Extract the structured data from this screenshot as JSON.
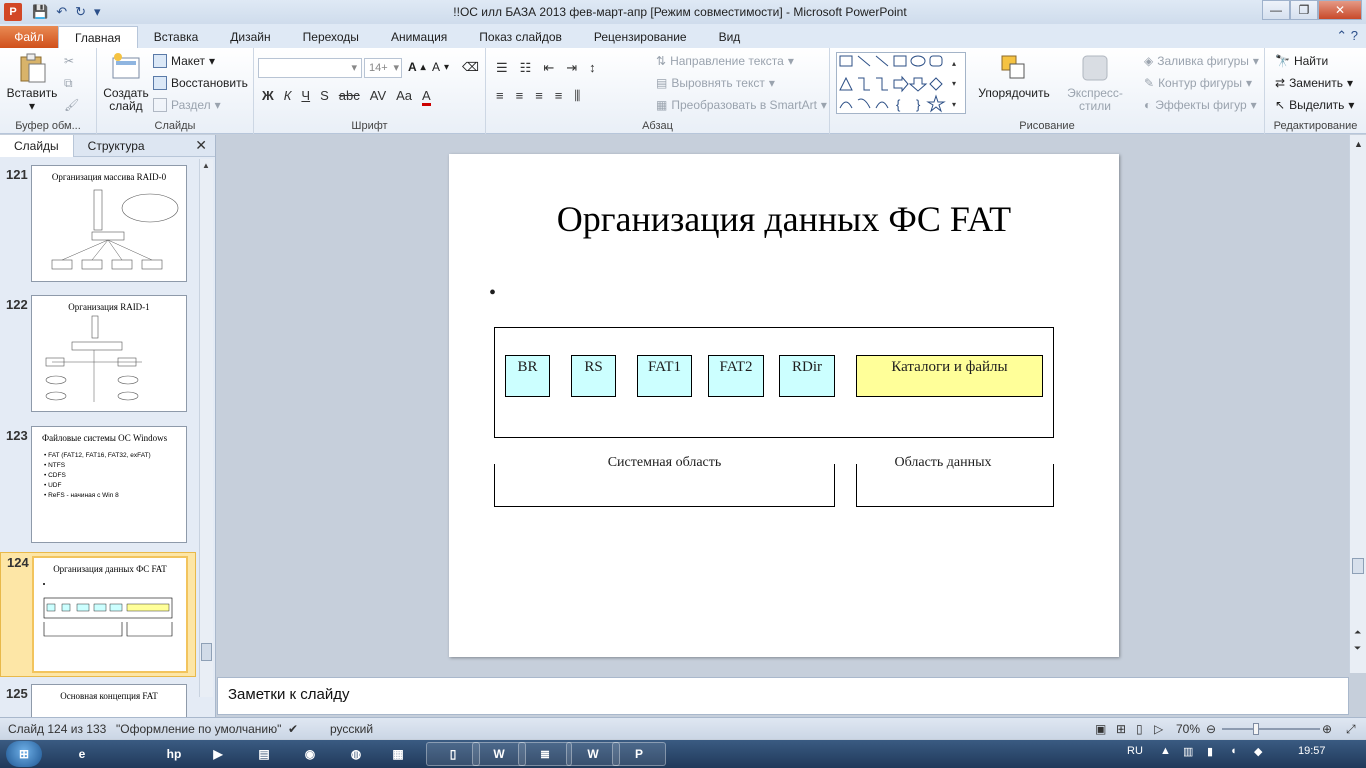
{
  "window": {
    "title": "!!ОС илл БАЗА  2013 фев-март-апр [Режим совместимости]  -  Microsoft PowerPoint",
    "app_icon": "P"
  },
  "tabs": [
    {
      "label": "Файл"
    },
    {
      "label": "Главная"
    },
    {
      "label": "Вставка"
    },
    {
      "label": "Дизайн"
    },
    {
      "label": "Переходы"
    },
    {
      "label": "Анимация"
    },
    {
      "label": "Показ слайдов"
    },
    {
      "label": "Рецензирование"
    },
    {
      "label": "Вид"
    }
  ],
  "ribbon": {
    "clipboard": {
      "label": "Буфер обм...",
      "paste": "Вставить"
    },
    "slides": {
      "label": "Слайды",
      "new_slide": "Создать слайд",
      "layout": "Макет",
      "reset": "Восстановить",
      "section": "Раздел"
    },
    "font": {
      "label": "Шрифт",
      "size": "14+",
      "bold": "Ж",
      "italic": "К",
      "underline": "Ч",
      "shadow": "S",
      "strike": "abc",
      "spacing": "AV",
      "case": "Aa",
      "color": "A"
    },
    "paragraph": {
      "label": "Абзац",
      "text_direction": "Направление текста",
      "align_text": "Выровнять текст",
      "smartart": "Преобразовать в SmartArt"
    },
    "drawing": {
      "label": "Рисование",
      "arrange": "Упорядочить",
      "quick_styles": "Экспресс-стили",
      "fill": "Заливка фигуры",
      "outline": "Контур фигуры",
      "effects": "Эффекты фигур"
    },
    "editing": {
      "label": "Редактирование",
      "find": "Найти",
      "replace": "Заменить",
      "select": "Выделить"
    }
  },
  "panel": {
    "tabs": [
      "Слайды",
      "Структура"
    ],
    "thumbnails": [
      {
        "number": "121",
        "title": "Организация массива RAID-0"
      },
      {
        "number": "122",
        "title": "Организация RAID-1"
      },
      {
        "number": "123",
        "title": "Файловые системы ОС Windows",
        "items": [
          "FAT  (FAT12, FAT16, FAT32, exFAT)",
          "NTFS",
          "CDFS",
          "UDF",
          "ReFS - начиная с Win 8"
        ]
      },
      {
        "number": "124",
        "title": "Организация данных ФС FAT"
      },
      {
        "number": "125",
        "title": "Основная концепция FAT"
      }
    ]
  },
  "slide": {
    "title": "Организация данных ФС FAT",
    "cells": [
      "BR",
      "RS",
      "FAT1",
      "FAT2",
      "RDir",
      "Каталоги и файлы"
    ],
    "system_area": "Системная область",
    "data_area": "Область данных"
  },
  "notes": {
    "placeholder": "Заметки к слайду"
  },
  "status": {
    "slide_info": "Слайд 124 из 133",
    "theme": "\"Оформление по умолчанию\"",
    "language": "русский",
    "zoom": "70%"
  },
  "taskbar": {
    "lang": "RU",
    "time": "19:57"
  },
  "colors": {
    "cyan_cell": "#ccffff",
    "yellow_cell": "#ffff99",
    "file_tab": "#d0501b"
  }
}
